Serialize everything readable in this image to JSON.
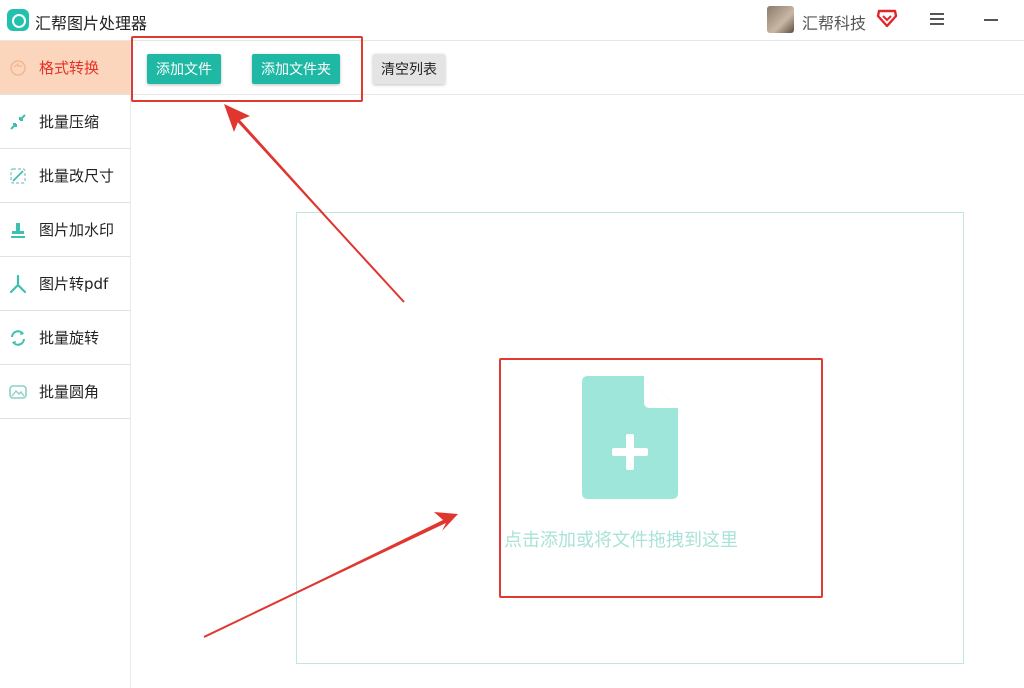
{
  "app": {
    "title": "汇帮图片处理器"
  },
  "user": {
    "name": "汇帮科技"
  },
  "sidebar": {
    "items": [
      {
        "label": "格式转换",
        "icon": "format-convert-icon",
        "active": true
      },
      {
        "label": "批量压缩",
        "icon": "compress-icon",
        "active": false
      },
      {
        "label": "批量改尺寸",
        "icon": "resize-icon",
        "active": false
      },
      {
        "label": "图片加水印",
        "icon": "watermark-icon",
        "active": false
      },
      {
        "label": "图片转pdf",
        "icon": "pdf-icon",
        "active": false
      },
      {
        "label": "批量旋转",
        "icon": "rotate-icon",
        "active": false
      },
      {
        "label": "批量圆角",
        "icon": "rounded-corner-icon",
        "active": false
      }
    ]
  },
  "toolbar": {
    "add_file_label": "添加文件",
    "add_folder_label": "添加文件夹",
    "clear_list_label": "清空列表"
  },
  "dropzone": {
    "hint": "点击添加或将文件拖拽到这里"
  },
  "colors": {
    "accent": "#1fb8a5",
    "active_bg": "#fcd6bc",
    "active_text": "#e5312a",
    "annotation_red": "#e03a33",
    "file_icon": "#9ee6da"
  }
}
